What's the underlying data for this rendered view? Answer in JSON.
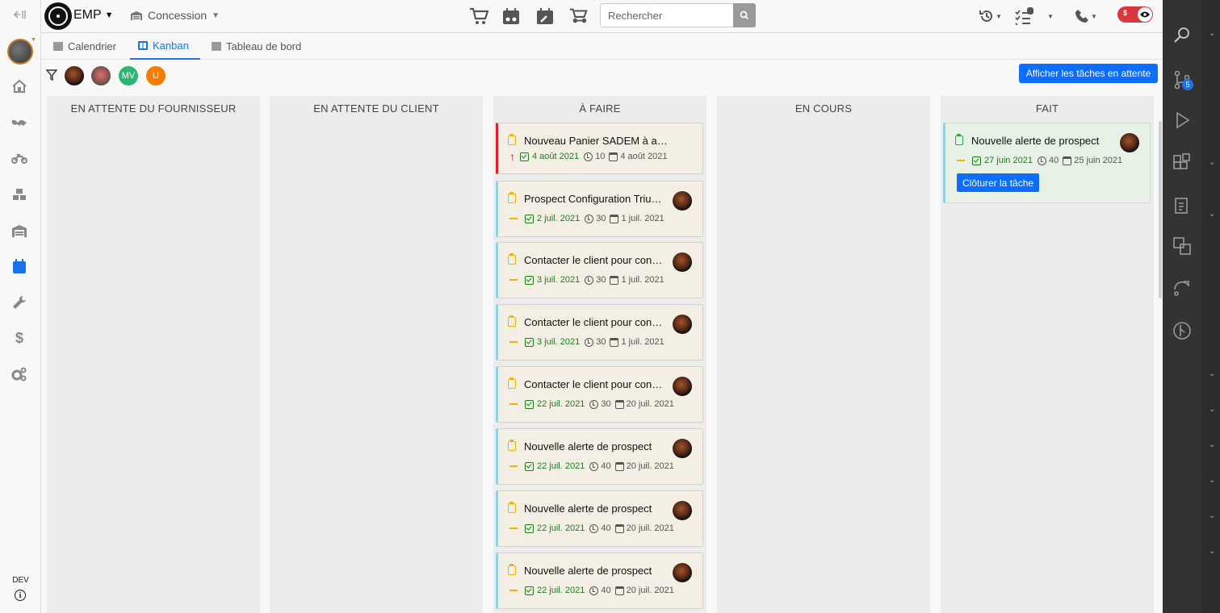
{
  "topbar": {
    "brand": "EMP",
    "site": "Concession",
    "search_placeholder": "Rechercher"
  },
  "tabs": [
    {
      "label": "Calendrier",
      "active": false
    },
    {
      "label": "Kanban",
      "active": true
    },
    {
      "label": "Tableau de bord",
      "active": false
    }
  ],
  "filters": {
    "users": [
      {
        "initials": "",
        "color": "#3a2a22"
      },
      {
        "initials": "",
        "color": "#b4584f"
      },
      {
        "initials": "MV",
        "color": "#2bb673"
      },
      {
        "initials": "U",
        "color": "#f57c00"
      }
    ],
    "pending_button": "Afficher les tâches en attente"
  },
  "sidebar": {
    "dev_label": "DEV",
    "info_glyph": "i"
  },
  "toggle": {
    "currency_glyph": "$"
  },
  "ide": {
    "badge": "5"
  },
  "kanban": {
    "columns": [
      {
        "title": "EN ATTENTE DU FOURNISSEUR",
        "cards": []
      },
      {
        "title": "EN ATTENTE DU CLIENT",
        "cards": []
      },
      {
        "title": "À FAIRE",
        "cards": [
          {
            "title": "Nouveau Panier SADEM à accep…",
            "priority": "high",
            "due": "4 août 2021",
            "duration": "10",
            "created": "4 août 2021",
            "avatar": false
          },
          {
            "title": "Prospect Configuration Triu…",
            "priority": "normal",
            "due": "2 juil. 2021",
            "duration": "30",
            "created": "1 juil. 2021",
            "avatar": true
          },
          {
            "title": "Contacter le client pour con…",
            "priority": "normal",
            "due": "3 juil. 2021",
            "duration": "30",
            "created": "1 juil. 2021",
            "avatar": true
          },
          {
            "title": "Contacter le client pour con…",
            "priority": "normal",
            "due": "3 juil. 2021",
            "duration": "30",
            "created": "1 juil. 2021",
            "avatar": true
          },
          {
            "title": "Contacter le client pour con…",
            "priority": "normal",
            "due": "22 juil. 2021",
            "duration": "30",
            "created": "20 juil. 2021",
            "avatar": true
          },
          {
            "title": "Nouvelle alerte de prospect",
            "priority": "normal",
            "due": "22 juil. 2021",
            "duration": "40",
            "created": "20 juil. 2021",
            "avatar": true
          },
          {
            "title": "Nouvelle alerte de prospect",
            "priority": "normal",
            "due": "22 juil. 2021",
            "duration": "40",
            "created": "20 juil. 2021",
            "avatar": true
          },
          {
            "title": "Nouvelle alerte de prospect",
            "priority": "normal",
            "due": "22 juil. 2021",
            "duration": "40",
            "created": "20 juil. 2021",
            "avatar": true
          }
        ]
      },
      {
        "title": "EN COURS",
        "cards": []
      },
      {
        "title": "FAIT",
        "cards": [
          {
            "title": "Nouvelle alerte de prospect",
            "priority": "normal",
            "due": "27 juin 2021",
            "duration": "40",
            "created": "25 juin 2021",
            "avatar": true,
            "done": true,
            "action": "Clôturer la tâche"
          }
        ]
      }
    ]
  }
}
